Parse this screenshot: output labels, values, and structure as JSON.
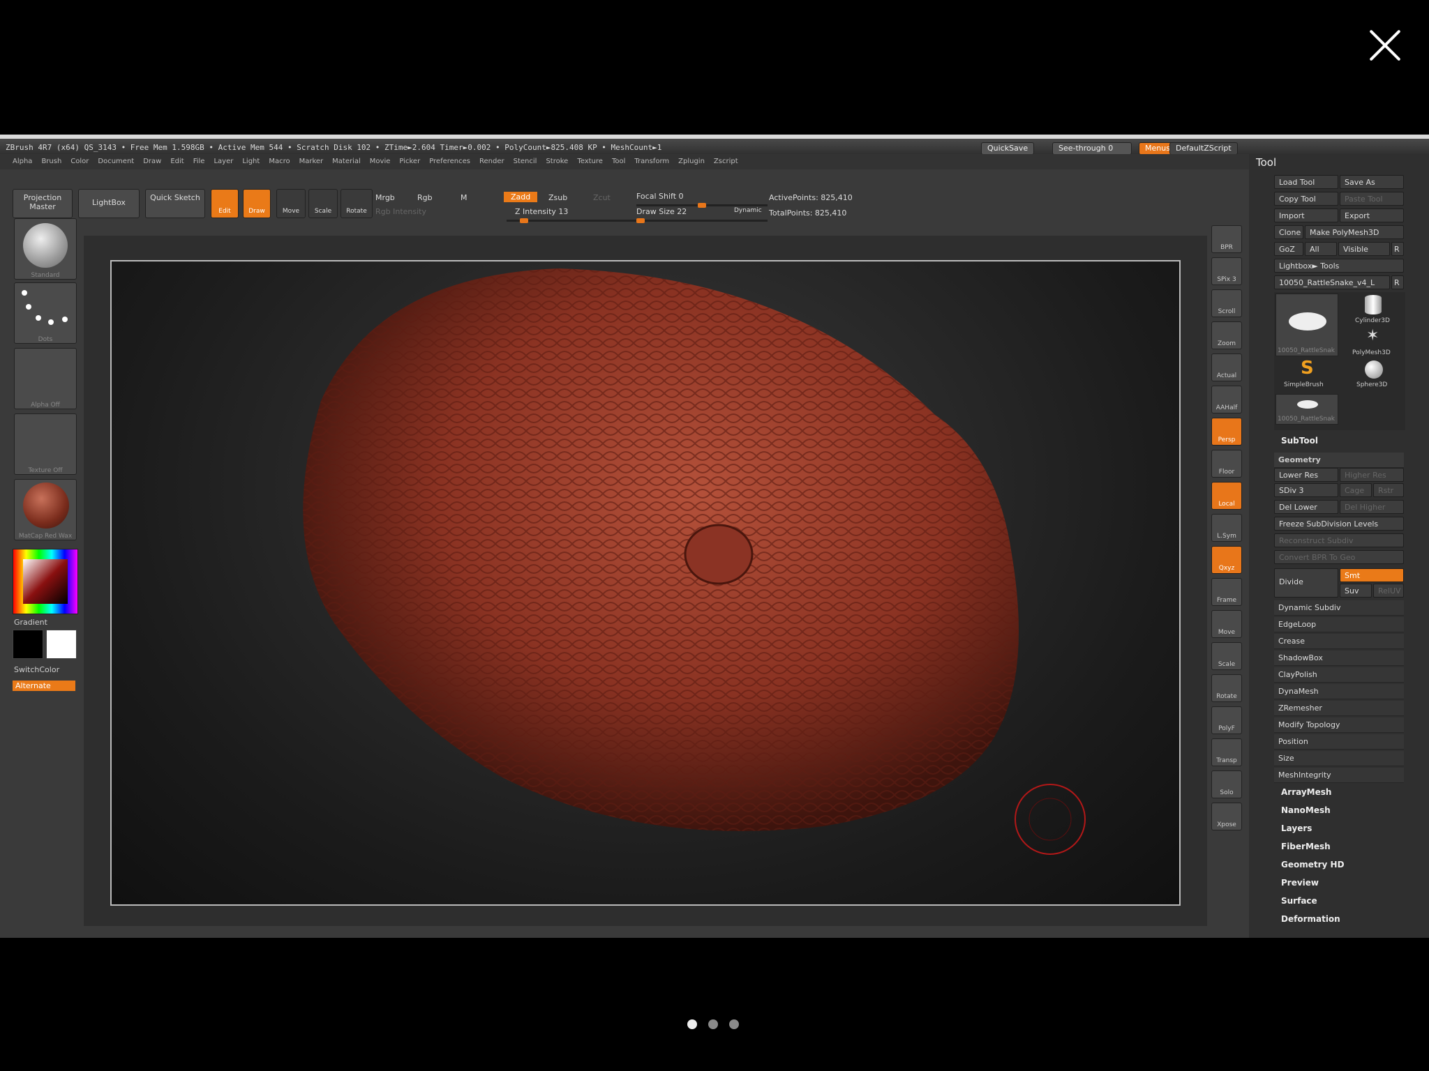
{
  "viewer": {
    "page_dots": 3,
    "active_dot": 0
  },
  "status": {
    "info": "ZBrush 4R7 (x64)   QS_3143   • Free Mem 1.598GB • Active Mem 544 • Scratch Disk 102 •  ZTime►2.604 Timer►0.002 • PolyCount►825.408 KP  • MeshCount►1",
    "quicksave": "QuickSave",
    "see_through": "See-through  0",
    "menus": "Menus",
    "default_script": "DefaultZScript"
  },
  "menubar": [
    "Alpha",
    "Brush",
    "Color",
    "Document",
    "Draw",
    "Edit",
    "File",
    "Layer",
    "Light",
    "Macro",
    "Marker",
    "Material",
    "Movie",
    "Picker",
    "Preferences",
    "Render",
    "Stencil",
    "Stroke",
    "Texture",
    "Tool",
    "Transform",
    "Zplugin",
    "Zscript"
  ],
  "topshelf": {
    "projection_master": "Projection Master",
    "lightbox": "LightBox",
    "quick_sketch": "Quick Sketch",
    "edit": "Edit",
    "draw": "Draw",
    "move": "Move",
    "scale": "Scale",
    "rotate": "Rotate",
    "mrgb": "Mrgb",
    "rgb": "Rgb",
    "m": "M",
    "rgb_intensity": "Rgb Intensity",
    "zadd": "Zadd",
    "zsub": "Zsub",
    "zcut": "Zcut",
    "z_intensity": "Z Intensity 13",
    "focal_shift": "Focal Shift 0",
    "draw_size": "Draw Size 22",
    "dynamic": "Dynamic",
    "active_points": "ActivePoints: 825,410",
    "total_points": "TotalPoints: 825,410",
    "z_intensity_value": 13,
    "focal_shift_value": 0,
    "draw_size_value": 22
  },
  "leftshelf": {
    "brush": "Standard",
    "stroke": "Dots",
    "alpha": "Alpha Off",
    "texture": "Texture Off",
    "material": "MatCap Red Wax",
    "gradient": "Gradient",
    "switchcolor": "SwitchColor",
    "alternate": "Alternate"
  },
  "rightshelf": [
    "BPR",
    "SPix 3",
    "Scroll",
    "Zoom",
    "Actual",
    "AAHalf",
    "Persp",
    "Floor",
    "Local",
    "L.Sym",
    "Qxyz",
    "Frame",
    "Move",
    "Scale",
    "Rotate",
    "PolyF",
    "Transp",
    "Solo",
    "Xpose"
  ],
  "tool": {
    "title": "Tool",
    "load_tool": "Load Tool",
    "save_as": "Save As",
    "copy_tool": "Copy Tool",
    "paste_tool": "Paste Tool",
    "import": "Import",
    "export": "Export",
    "clone": "Clone",
    "make_polymesh": "Make PolyMesh3D",
    "goz": "GoZ",
    "all": "All",
    "visible": "Visible",
    "r": "R",
    "lightbox_tools": "Lightbox► Tools",
    "current_tool": "10050_RattleSnake_v4_L",
    "thumbs": [
      "10050_RattleSnak",
      "Cylinder3D",
      "PolyMesh3D",
      "SimpleBrush",
      "Sphere3D",
      "10050_RattleSnak"
    ],
    "subtool": "SubTool",
    "geometry": "Geometry",
    "lower_res": "Lower Res",
    "higher_res": "Higher Res",
    "sdiv": "SDiv 3",
    "cage": "Cage",
    "rstr": "Rstr",
    "del_lower": "Del Lower",
    "del_higher": "Del Higher",
    "freeze": "Freeze SubDivision Levels",
    "reconstruct": "Reconstruct Subdiv",
    "convert_bpr": "Convert BPR To Geo",
    "divide": "Divide",
    "smt": "Smt",
    "suv": "Suv",
    "reluv": "RelUV",
    "geometry_items": [
      "Dynamic Subdiv",
      "EdgeLoop",
      "Crease",
      "ShadowBox",
      "ClayPolish",
      "DynaMesh",
      "ZRemesher",
      "Modify Topology",
      "Position",
      "Size",
      "MeshIntegrity"
    ],
    "sections": [
      "ArrayMesh",
      "NanoMesh",
      "Layers",
      "FiberMesh",
      "Geometry HD",
      "Preview",
      "Surface",
      "Deformation"
    ]
  }
}
